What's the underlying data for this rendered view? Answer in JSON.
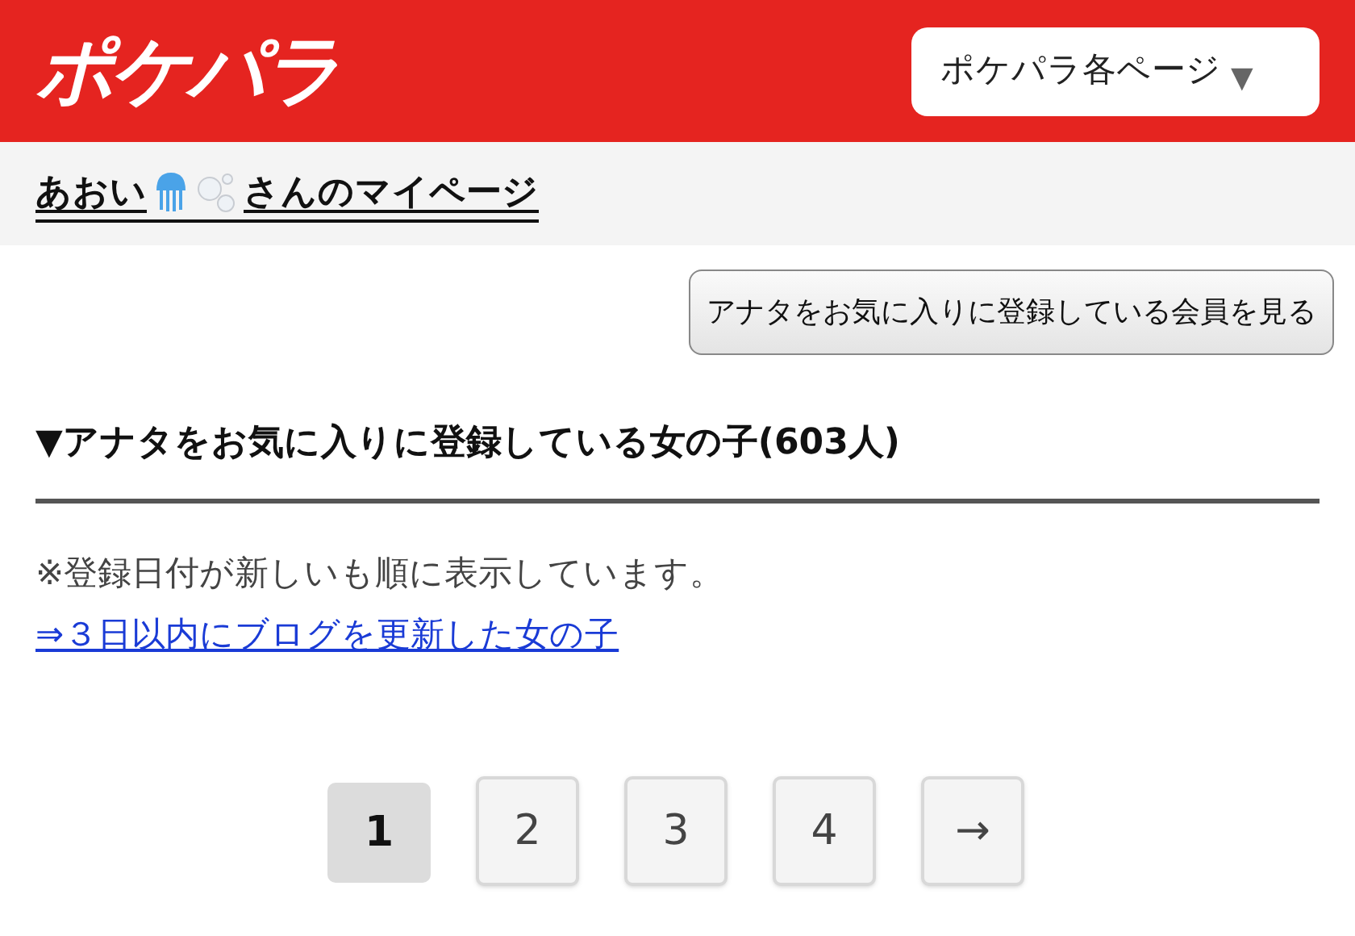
{
  "header": {
    "logo": "ポケパラ",
    "menu": {
      "label": "ポケパラ各ページ",
      "caret": "▼"
    }
  },
  "profile_link": {
    "before": "あおい",
    "after": "さんのマイページ"
  },
  "favorited_by_button": "アナタをお気に入りに登録している会員を見る",
  "section": {
    "title": "▼アナタをお気に入りに登録している女の子(603人)",
    "note": "※登録日付が新しいも順に表示しています。",
    "link": "⇒３日以内にブログを更新した女の子"
  },
  "pagination": [
    {
      "label": "1",
      "selected": true
    },
    {
      "label": "2",
      "selected": false
    },
    {
      "label": "3",
      "selected": false
    },
    {
      "label": "4",
      "selected": false
    },
    {
      "label": "→",
      "selected": false
    }
  ]
}
